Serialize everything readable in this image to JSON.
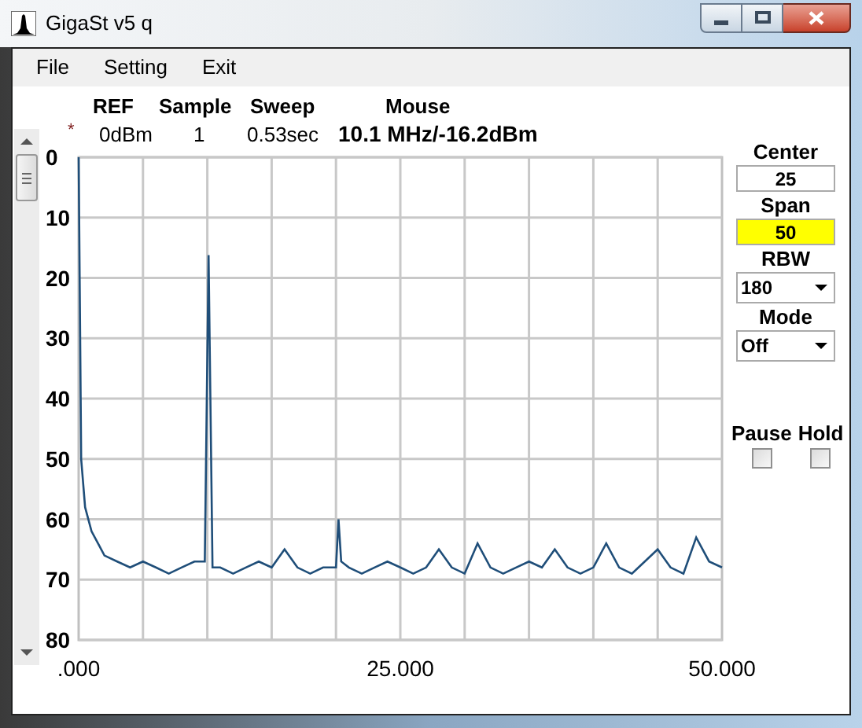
{
  "window": {
    "title": "GigaSt v5 q"
  },
  "menu": [
    "File",
    "Setting",
    "Exit"
  ],
  "status": [
    {
      "label": "REF",
      "value": "0dBm"
    },
    {
      "label": "Sample",
      "value": "1"
    },
    {
      "label": "Sweep",
      "value": "0.53sec"
    },
    {
      "label": "Mouse",
      "value": "10.1 MHz/-16.2dBm"
    }
  ],
  "marker": "*",
  "chart": {
    "chart_data": {
      "type": "line",
      "grid": true,
      "xlim": [
        0,
        50
      ],
      "ylim": [
        80,
        0
      ],
      "xticks": [
        {
          "value": 0,
          "label": ".000"
        },
        {
          "value": 25,
          "label": "25.000"
        },
        {
          "value": 50,
          "label": "50.000"
        }
      ],
      "yticks": [
        0,
        10,
        20,
        30,
        40,
        50,
        60,
        70,
        80
      ],
      "x": [
        0,
        0.2,
        0.5,
        1,
        1.5,
        2,
        3,
        4,
        5,
        6,
        7,
        8,
        9,
        9.8,
        10.1,
        10.4,
        11,
        12,
        13,
        14,
        15,
        16,
        17,
        18,
        19,
        20,
        20.2,
        20.4,
        21,
        22,
        23,
        24,
        25,
        26,
        27,
        28,
        29,
        30,
        31,
        32,
        33,
        34,
        35,
        36,
        37,
        38,
        39,
        40,
        41,
        42,
        43,
        44,
        45,
        46,
        47,
        48,
        49,
        50
      ],
      "series": [
        {
          "color": "#1f4e79",
          "values": [
            0,
            50,
            58,
            62,
            64,
            66,
            67,
            68,
            67,
            68,
            69,
            68,
            67,
            67,
            16.2,
            68,
            68,
            69,
            68,
            67,
            68,
            65,
            68,
            69,
            68,
            68,
            60,
            67,
            68,
            69,
            68,
            67,
            68,
            69,
            68,
            65,
            68,
            69,
            64,
            68,
            69,
            68,
            67,
            68,
            65,
            68,
            69,
            68,
            64,
            68,
            69,
            67,
            65,
            68,
            69,
            63,
            67,
            68
          ]
        }
      ]
    }
  },
  "controls": [
    {
      "kind": "field",
      "label": "Center",
      "value": "25",
      "highlighted": false
    },
    {
      "kind": "field",
      "label": "Span",
      "value": "50",
      "highlighted": true
    },
    {
      "kind": "dropdown",
      "label": "RBW",
      "value": "180"
    },
    {
      "kind": "dropdown",
      "label": "Mode",
      "value": "Off"
    }
  ],
  "checkboxes": [
    {
      "label": "Pause",
      "checked": false
    },
    {
      "label": "Hold",
      "checked": false
    }
  ]
}
